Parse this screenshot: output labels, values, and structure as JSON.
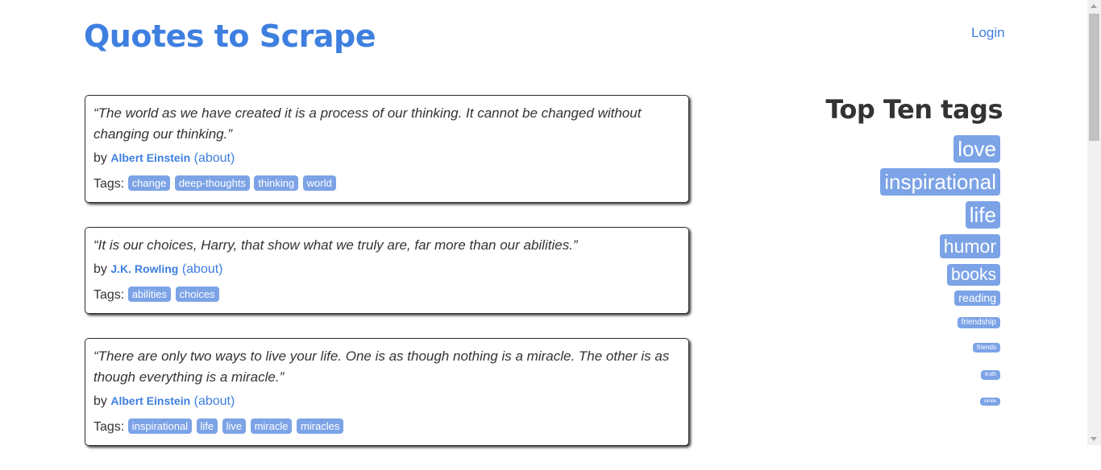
{
  "header": {
    "title": "Quotes to Scrape",
    "login_label": "Login"
  },
  "quotes": [
    {
      "text": "“The world as we have created it is a process of our thinking. It cannot be changed without changing our thinking.”",
      "by_prefix": "by",
      "author": "Albert Einstein",
      "about_label": "(about)",
      "tags_label": "Tags:",
      "tags": [
        "change",
        "deep-thoughts",
        "thinking",
        "world"
      ]
    },
    {
      "text": "“It is our choices, Harry, that show what we truly are, far more than our abilities.”",
      "by_prefix": "by",
      "author": "J.K. Rowling",
      "about_label": "(about)",
      "tags_label": "Tags:",
      "tags": [
        "abilities",
        "choices"
      ]
    },
    {
      "text": "“There are only two ways to live your life. One is as though nothing is a miracle. The other is as though everything is a miracle.”",
      "by_prefix": "by",
      "author": "Albert Einstein",
      "about_label": "(about)",
      "tags_label": "Tags:",
      "tags": [
        "inspirational",
        "life",
        "live",
        "miracle",
        "miracles"
      ]
    }
  ],
  "sidebar": {
    "heading": "Top Ten tags",
    "tags": [
      "love",
      "inspirational",
      "life",
      "humor",
      "books",
      "reading",
      "friendship",
      "friends",
      "truth",
      "simile"
    ]
  },
  "colors": {
    "accent": "#3e7fe0",
    "tag_bg": "#7ca3e6",
    "text": "#333333"
  }
}
